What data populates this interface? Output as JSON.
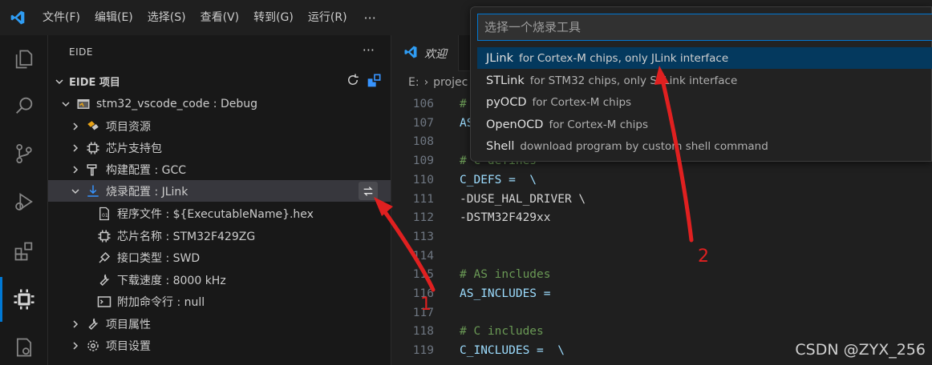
{
  "menubar": {
    "items": [
      "文件(F)",
      "编辑(E)",
      "选择(S)",
      "查看(V)",
      "转到(G)",
      "运行(R)"
    ],
    "more": "···"
  },
  "activitybar": {
    "icons": [
      "explorer-icon",
      "search-icon",
      "source-control-icon",
      "run-debug-icon",
      "extensions-icon",
      "eide-chip-icon",
      "remote-icon"
    ],
    "active": "eide-chip-icon",
    "accent": "#0078d4"
  },
  "sidebar": {
    "title": "EIDE",
    "more": "···",
    "section_title": "EIDE 项目",
    "project": "stm32_vscode_code : Debug",
    "items": [
      "项目资源",
      "芯片支持包",
      "构建配置 : GCC",
      "烧录配置 : JLink",
      "程序文件 : ${ExecutableName}.hex",
      "芯片名称 : STM32F429ZG",
      "接口类型 : SWD",
      "下载速度 : 8000 kHz",
      "附加命令行 : null",
      "项目属性",
      "项目设置"
    ]
  },
  "editor": {
    "tab_label": "欢迎",
    "breadcrumb": [
      "E:",
      "projec"
    ],
    "lines": [
      {
        "n": "106",
        "t": "# ",
        "c": "cm"
      },
      {
        "n": "107",
        "t": "AS",
        "c": "kw"
      },
      {
        "n": "108",
        "t": "",
        "c": "op"
      },
      {
        "n": "109",
        "t": "# C defines",
        "c": "cm"
      },
      {
        "n": "110",
        "t": "C_DEFS =  \\",
        "c": "kw"
      },
      {
        "n": "111",
        "t": "-DUSE_HAL_DRIVER \\",
        "c": "op"
      },
      {
        "n": "112",
        "t": "-DSTM32F429xx",
        "c": "op"
      },
      {
        "n": "113",
        "t": "",
        "c": "op"
      },
      {
        "n": "114",
        "t": "",
        "c": "op"
      },
      {
        "n": "115",
        "t": "# AS includes",
        "c": "cm"
      },
      {
        "n": "116",
        "t": "AS_INCLUDES =",
        "c": "kw"
      },
      {
        "n": "117",
        "t": "",
        "c": "op"
      },
      {
        "n": "118",
        "t": "# C includes",
        "c": "cm"
      },
      {
        "n": "119",
        "t": "C_INCLUDES =  \\",
        "c": "kw"
      }
    ]
  },
  "quickpick": {
    "placeholder": "选择一个烧录工具",
    "items": [
      {
        "name": "JLink",
        "desc": "for Cortex-M chips, only JLink interface"
      },
      {
        "name": "STLink",
        "desc": "for STM32 chips, only STLink interface"
      },
      {
        "name": "pyOCD",
        "desc": "for Cortex-M chips"
      },
      {
        "name": "OpenOCD",
        "desc": "for Cortex-M chips"
      },
      {
        "name": "Shell",
        "desc": "download program by custom shell command"
      }
    ],
    "active_index": 0
  },
  "annotations": {
    "label_1": "1",
    "label_2": "2",
    "arrow_color": "#e02020"
  },
  "watermark": "CSDN @ZYX_256"
}
